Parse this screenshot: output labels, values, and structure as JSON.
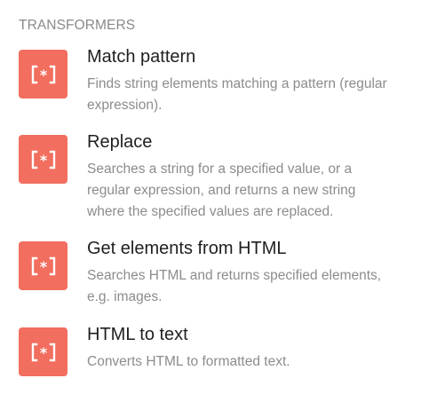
{
  "section": {
    "title": "TRANSFORMERS"
  },
  "colors": {
    "icon_bg": "#f26e5e",
    "title": "#1f1f1f",
    "description": "#8c8c8c",
    "header": "#8a8a8a"
  },
  "items": [
    {
      "icon": "regex-brackets-icon",
      "title": "Match pattern",
      "description": "Finds string elements matching a pattern (regular expression)."
    },
    {
      "icon": "regex-brackets-icon",
      "title": "Replace",
      "description": "Searches a string for a specified value, or a regular expression, and returns a new string where the specified values are replaced."
    },
    {
      "icon": "regex-brackets-icon",
      "title": "Get elements from HTML",
      "description": "Searches HTML and returns specified elements, e.g. images."
    },
    {
      "icon": "regex-brackets-icon",
      "title": "HTML to text",
      "description": "Converts HTML to formatted text."
    }
  ]
}
